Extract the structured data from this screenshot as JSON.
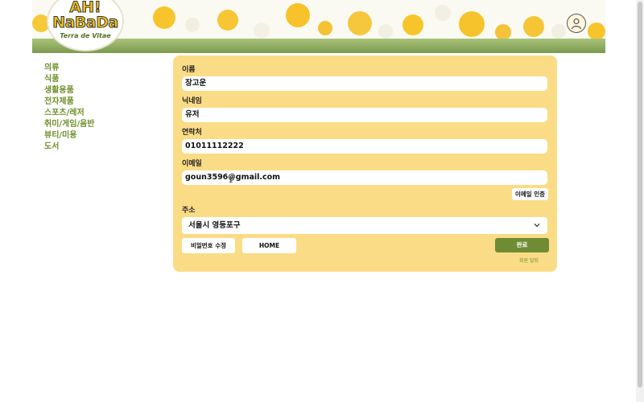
{
  "header": {
    "logo_line1": "AH!",
    "logo_line2": "NaBaDa",
    "logo_line3": "Terra de Vitae",
    "profile_icon": "user-icon"
  },
  "sidebar": {
    "items": [
      {
        "label": "의류"
      },
      {
        "label": "식품"
      },
      {
        "label": "생활용품"
      },
      {
        "label": "전자제품"
      },
      {
        "label": "스포츠/레저"
      },
      {
        "label": "취미/게임/음반"
      },
      {
        "label": "뷰티/미용"
      },
      {
        "label": "도서"
      }
    ]
  },
  "form": {
    "name_label": "이름",
    "name_value": "장고운",
    "nickname_label": "닉네임",
    "nickname_value": "유저",
    "phone_label": "연락처",
    "phone_value": "01011112222",
    "email_label": "이메일",
    "email_value": "goun3596@gmail.com",
    "email_verify_button": "이메일 인증",
    "address_label": "주소",
    "address_value": "서울시 영등포구",
    "change_password_button": "비밀번호 수정",
    "home_button": "HOME",
    "done_button": "완료",
    "withdraw_link": "회원 탈퇴"
  },
  "colors": {
    "panel": "#fbdc86",
    "accent_green": "#6f8b34",
    "sidebar_text": "#6e8f2a"
  }
}
